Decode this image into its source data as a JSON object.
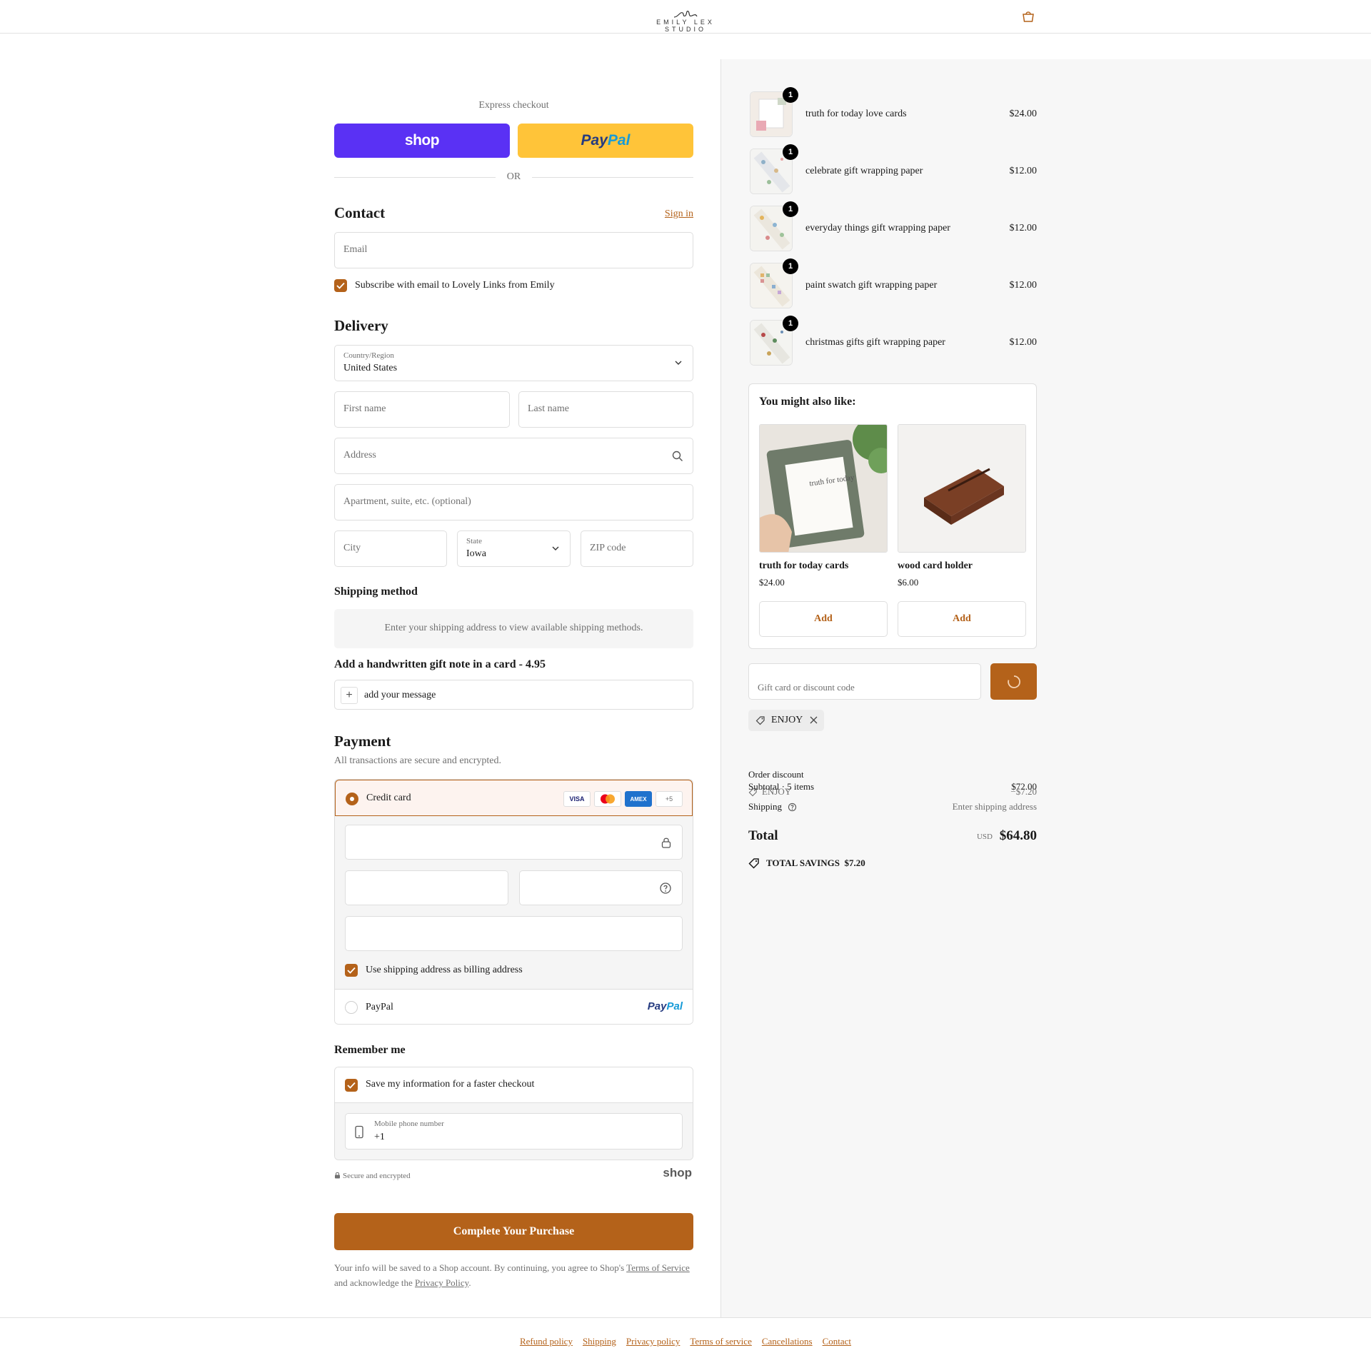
{
  "header": {
    "brand": "EMILY LEX STUDIO"
  },
  "express": {
    "label": "Express checkout",
    "shop_label": "shop",
    "paypal_pay": "Pay",
    "paypal_pal": "Pal",
    "or": "OR"
  },
  "contact": {
    "title": "Contact",
    "sign_in": "Sign in",
    "email_placeholder": "Email",
    "subscribe_label": "Subscribe with email to Lovely Links from Emily"
  },
  "delivery": {
    "title": "Delivery",
    "country_label": "Country/Region",
    "country_value": "United States",
    "first_name": "First name",
    "last_name": "Last name",
    "address": "Address",
    "apartment": "Apartment, suite, etc. (optional)",
    "city": "City",
    "state_label": "State",
    "state_value": "Iowa",
    "zip": "ZIP code"
  },
  "shipping": {
    "title": "Shipping method",
    "message": "Enter your shipping address to view available shipping methods."
  },
  "gift_note": {
    "title": "Add a handwritten gift note in a card - 4.95",
    "action": "add your message"
  },
  "payment": {
    "title": "Payment",
    "description": "All transactions are secure and encrypted.",
    "credit_card_label": "Credit card",
    "cards": [
      "VISA",
      "AMEX",
      "+5"
    ],
    "billing_label": "Use shipping address as billing address",
    "paypal_label": "PayPal",
    "paypal_logo_pay": "Pay",
    "paypal_logo_pal": "Pal"
  },
  "remember": {
    "title": "Remember me",
    "save_label": "Save my information for a faster checkout",
    "phone_label": "Mobile phone number",
    "phone_value": "+1"
  },
  "secure": {
    "text": "Secure and encrypted",
    "shop_logo": "shop"
  },
  "complete_button": "Complete Your Purchase",
  "legal": {
    "prefix": "Your info will be saved to a Shop account. By continuing, you agree to Shop's ",
    "terms": "Terms of Service",
    "middle": " and acknowledge the ",
    "privacy": "Privacy Policy",
    "suffix": "."
  },
  "cart": {
    "items": [
      {
        "name": "truth for today love cards",
        "price": "$24.00",
        "qty": "1"
      },
      {
        "name": "celebrate gift wrapping paper",
        "price": "$12.00",
        "qty": "1"
      },
      {
        "name": "everyday things gift wrapping paper",
        "price": "$12.00",
        "qty": "1"
      },
      {
        "name": "paint swatch gift wrapping paper",
        "price": "$12.00",
        "qty": "1"
      },
      {
        "name": "christmas gifts gift wrapping paper",
        "price": "$12.00",
        "qty": "1"
      }
    ]
  },
  "upsell": {
    "title": "You might also like:",
    "products": [
      {
        "name": "truth for today cards",
        "price": "$24.00",
        "add": "Add",
        "image_text": "truth for today"
      },
      {
        "name": "wood card holder",
        "price": "$6.00",
        "add": "Add"
      }
    ]
  },
  "discount": {
    "placeholder": "Gift card or discount code",
    "applied_code": "ENJOY"
  },
  "summary": {
    "order_discount_label": "Order discount",
    "discount_code": "ENJOY",
    "discount_value": "−$7.20",
    "subtotal_label": "Subtotal · 5 items",
    "subtotal_value": "$72.00",
    "shipping_label": "Shipping",
    "shipping_value": "Enter shipping address",
    "total_label": "Total",
    "currency": "USD",
    "total_value": "$64.80",
    "savings_label": "TOTAL SAVINGS",
    "savings_value": "$7.20"
  },
  "footer": {
    "links": [
      "Refund policy",
      "Shipping",
      "Privacy policy",
      "Terms of service",
      "Cancellations",
      "Contact"
    ]
  },
  "colors": {
    "accent": "#b4621a",
    "shop_purple": "#5a31f4",
    "paypal_yellow": "#ffc439"
  }
}
